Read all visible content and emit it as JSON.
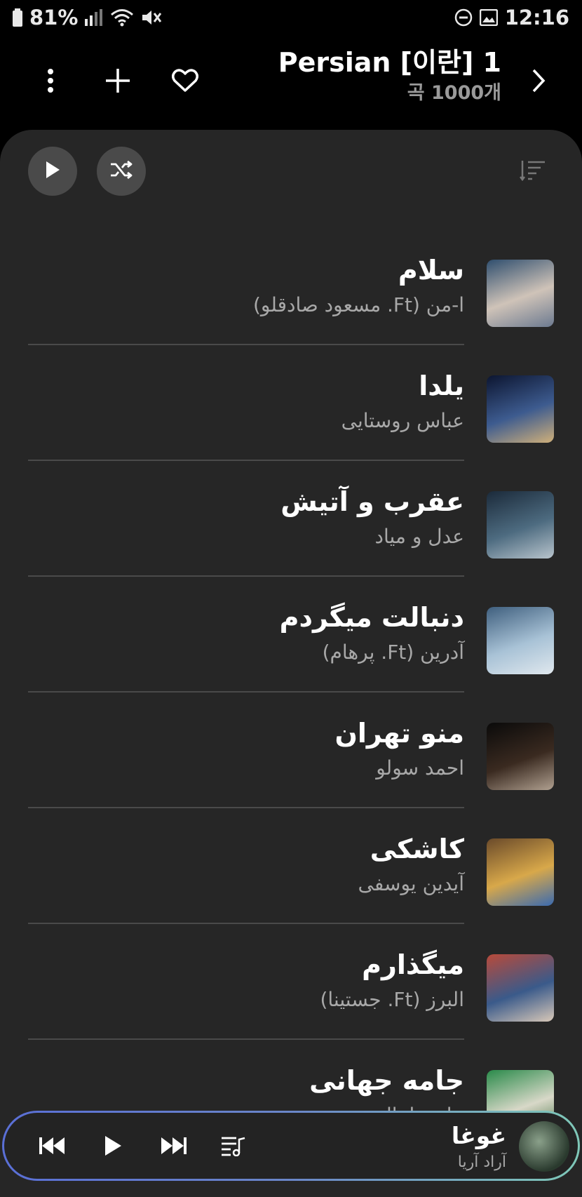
{
  "status_bar": {
    "battery": "81%",
    "time": "12:16"
  },
  "header": {
    "title": "Persian [이란] 1",
    "count": "곡 1000개"
  },
  "songs": [
    {
      "title": "سلام",
      "artist": "ا-من (Ft. مسعود صادقلو)",
      "art_colors": [
        "#2f4e6e",
        "#cfc3b8",
        "#6c7a90"
      ]
    },
    {
      "title": "یلدا",
      "artist": "عباس روستایی",
      "art_colors": [
        "#0c1530",
        "#3d5b8f",
        "#d0b07a"
      ]
    },
    {
      "title": "عقرب و آتیش",
      "artist": "عدل و میاد",
      "art_colors": [
        "#1b2a3a",
        "#4d6b80",
        "#b8c4cc"
      ]
    },
    {
      "title": "دنبالت میگردم",
      "artist": "آدرین (Ft. پرهام)",
      "art_colors": [
        "#3f5f7e",
        "#a8c2d6",
        "#e0e8ee"
      ]
    },
    {
      "title": "منو تهران",
      "artist": "احمد سولو",
      "art_colors": [
        "#0a0a0a",
        "#3a2a20",
        "#b0a090"
      ]
    },
    {
      "title": "کاشکی",
      "artist": "آیدین یوسفی",
      "art_colors": [
        "#6a4a2a",
        "#d8a84a",
        "#3a6ab0"
      ]
    },
    {
      "title": "میگذارم",
      "artist": "البرز (Ft. جستینا)",
      "art_colors": [
        "#b84a3a",
        "#3a5a8a",
        "#d8c8b8"
      ]
    },
    {
      "title": "جامه جهانی",
      "artist": "علی دانیال",
      "art_colors": [
        "#2a8a4a",
        "#d8d8c8",
        "#3a6a3a"
      ]
    }
  ],
  "now_playing": {
    "title": "غوغا",
    "artist": "آراد آریا",
    "art_colors": [
      "#2a3a2e",
      "#8aa08a"
    ]
  },
  "icons": {
    "more": "more-vertical-icon",
    "add": "plus-icon",
    "favorite": "heart-icon",
    "next": "chevron-right-icon",
    "play": "play-icon",
    "shuffle": "shuffle-icon",
    "sort": "sort-icon",
    "prev_track": "skip-previous-icon",
    "next_track": "skip-next-icon",
    "queue": "queue-music-icon"
  }
}
